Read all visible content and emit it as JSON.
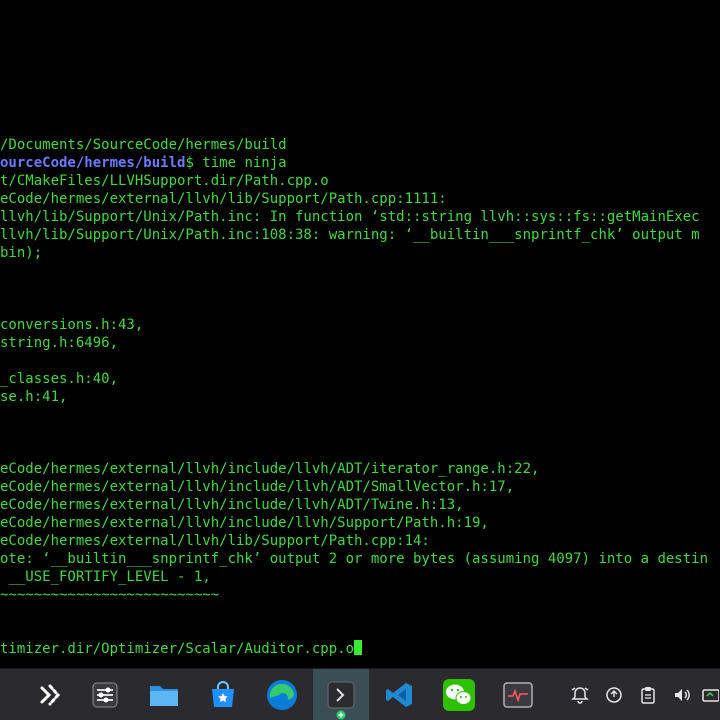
{
  "terminal": {
    "lines": [
      "/Documents/SourceCode/hermes/build",
      "",
      "t/CMakeFiles/LLVHSupport.dir/Path.cpp.o",
      "eCode/hermes/external/llvh/lib/Support/Path.cpp:1111:",
      "llvh/lib/Support/Unix/Path.inc: In function ‘std::string llvh::sys::fs::getMainExec",
      "llvh/lib/Support/Unix/Path.inc:108:38: warning: ‘__builtin___snprintf_chk’ output m",
      "bin);",
      "conversions.h:43,",
      "string.h:6496,",
      "_classes.h:40,",
      "se.h:41,",
      "eCode/hermes/external/llvh/include/llvh/ADT/iterator_range.h:22,",
      "eCode/hermes/external/llvh/include/llvh/ADT/SmallVector.h:17,",
      "eCode/hermes/external/llvh/include/llvh/ADT/Twine.h:13,",
      "eCode/hermes/external/llvh/include/llvh/Support/Path.h:19,",
      "eCode/hermes/external/llvh/lib/Support/Path.cpp:14:",
      "ote: ‘__builtin___snprintf_chk’ output 2 or more bytes (assuming 4097) into a destin",
      " __USE_FORTIFY_LEVEL - 1,",
      "~~~~~~~~~~~~~~~~~~~~~~~~~~",
      "timizer.dir/Optimizer/Scalar/Auditor.cpp.o"
    ],
    "prompt_path": "ourceCode/hermes/build",
    "prompt_command": "$ time ninja"
  },
  "taskbar": {
    "apps": [
      "launcher-icon",
      "control-center-icon",
      "file-manager-icon",
      "app-store-icon",
      "edge-browser-icon",
      "terminal-icon",
      "vscode-icon",
      "wechat-icon",
      "system-monitor-icon"
    ],
    "tray": [
      "notification-bell-icon",
      "update-icon",
      "clipboard-icon",
      "volume-icon",
      "network-icon"
    ]
  },
  "colors": {
    "terminal_bg": "#000000",
    "terminal_text": "#3ddc3d",
    "prompt_path": "#6a7bff",
    "taskbar_bg": "#2b2b2f",
    "active_app": "#3b4e56"
  }
}
